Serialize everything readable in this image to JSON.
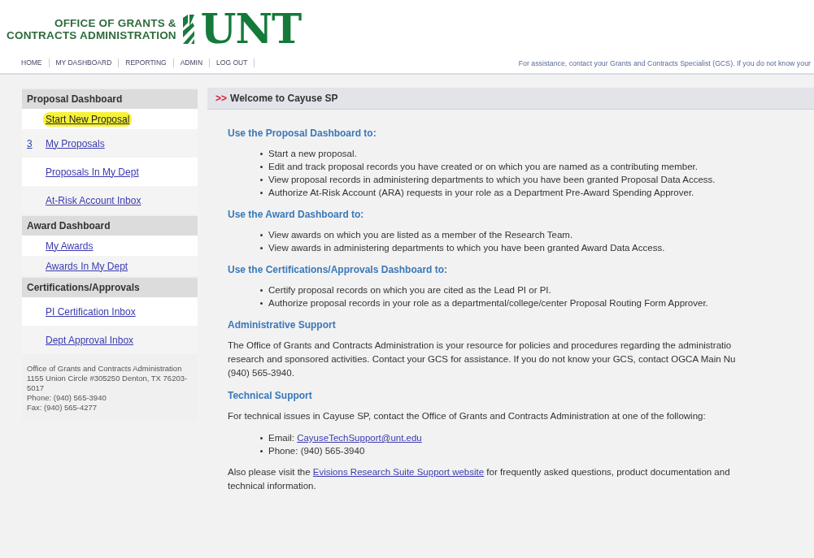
{
  "header": {
    "office_lines": [
      "OFFICE OF GRANTS &",
      "CONTRACTS ADMINISTRATION"
    ],
    "logo_text": "UNT",
    "nav": [
      "HOME",
      "MY DASHBOARD",
      "REPORTING",
      "ADMIN",
      "LOG OUT"
    ],
    "assistance": "For assistance, contact your Grants and Contracts Specialist (GCS). If you do not know your"
  },
  "sidebar": {
    "sections": [
      {
        "title": "Proposal Dashboard",
        "items": [
          {
            "label": "Start New Proposal",
            "highlighted": true,
            "kind": "compact"
          },
          {
            "label": "My Proposals",
            "count": "3",
            "highlighted": false,
            "kind": "roomy"
          },
          {
            "label": "Proposals In My Dept",
            "highlighted": false,
            "kind": "roomy"
          },
          {
            "label": "At-Risk Account Inbox",
            "highlighted": false,
            "kind": "roomy"
          }
        ]
      },
      {
        "title": "Award Dashboard",
        "items": [
          {
            "label": "My Awards",
            "highlighted": false,
            "kind": "compact"
          },
          {
            "label": "Awards In My Dept",
            "highlighted": false,
            "kind": "compact"
          }
        ]
      },
      {
        "title": "Certifications/Approvals",
        "items": [
          {
            "label": "PI Certification Inbox",
            "highlighted": false,
            "kind": "roomy"
          },
          {
            "label": "Dept Approval Inbox",
            "highlighted": false,
            "kind": "roomy"
          }
        ]
      }
    ],
    "contact": [
      "Office of Grants and Contracts Administration",
      "1155 Union Circle #305250 Denton, TX 76203-5017",
      "Phone: (940) 565-3940",
      "Fax: (940) 565-4277"
    ]
  },
  "main": {
    "marker": ">>",
    "title": "Welcome to Cayuse SP",
    "blocks": [
      {
        "kind": "list",
        "heading": "Use the Proposal Dashboard to:",
        "items": [
          "Start a new proposal.",
          "Edit and track proposal records you have created or on which you are named as a contributing member.",
          "View proposal records in administering departments to which you have been granted Proposal Data Access.",
          "Authorize At-Risk Account (ARA) requests in your role as a Department Pre-Award Spending Approver."
        ]
      },
      {
        "kind": "list",
        "heading": "Use the Award Dashboard to:",
        "items": [
          "View awards on which you are listed as a member of the Research Team.",
          "View awards in administering departments to which you have been granted Award Data Access."
        ]
      },
      {
        "kind": "list",
        "heading": "Use the Certifications/Approvals Dashboard to:",
        "items": [
          "Certify proposal records on which you are cited as the Lead PI or PI.",
          "Authorize proposal records in your role as a departmental/college/center Proposal Routing Form Approver."
        ]
      },
      {
        "kind": "paragraph",
        "heading": "Administrative Support",
        "lines": [
          "The Office of Grants and Contracts Administration is your resource for policies and procedures regarding the administratio",
          "research and sponsored activities. Contact your GCS for assistance. If you do not know your GCS, contact OGCA Main Nu",
          "(940) 565-3940."
        ]
      },
      {
        "kind": "support",
        "heading": "Technical Support",
        "intro": "For technical issues in Cayuse SP, contact the Office of Grants and Contracts Administration at one of the following:",
        "email_label": "Email:",
        "email": "CayuseTechSupport@unt.edu",
        "phone": "Phone: (940) 565-3940",
        "visit_before": "Also please visit the",
        "visit_link": "Evisions Research Suite Support website",
        "visit_after": "for frequently asked questions, product documentation and",
        "visit_line2": "technical information."
      }
    ]
  }
}
